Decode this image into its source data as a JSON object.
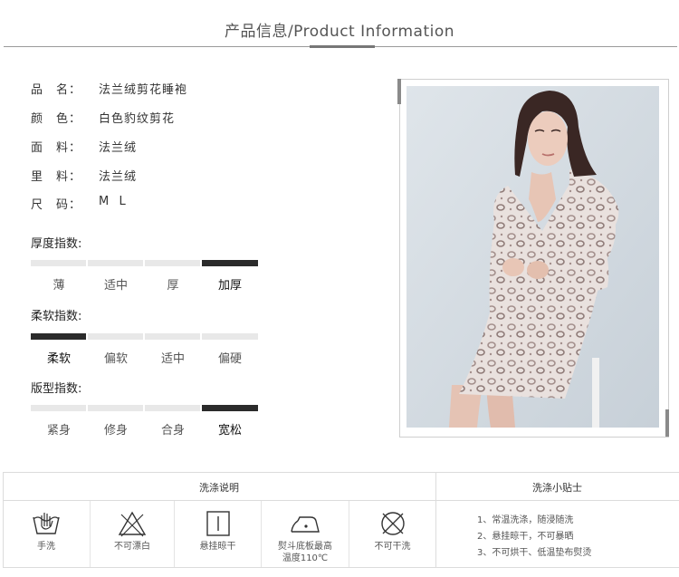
{
  "header": {
    "title": "产品信息/Product Information"
  },
  "specs": [
    {
      "label": "品　名：",
      "value": "法兰绒剪花睡袍"
    },
    {
      "label": "颜　色：",
      "value": "白色豹纹剪花"
    },
    {
      "label": "面　料：",
      "value": "法兰绒"
    },
    {
      "label": "里　料：",
      "value": "法兰绒"
    },
    {
      "label": "尺　码：",
      "value": "M  L"
    }
  ],
  "indices": [
    {
      "title": "厚度指数:",
      "options": [
        "薄",
        "适中",
        "厚",
        "加厚"
      ],
      "selected": "加厚"
    },
    {
      "title": "柔软指数:",
      "options": [
        "柔软",
        "偏软",
        "适中",
        "偏硬"
      ],
      "selected": "柔软"
    },
    {
      "title": "版型指数:",
      "options": [
        "紧身",
        "修身",
        "合身",
        "宽松"
      ],
      "selected": "宽松"
    }
  ],
  "care": {
    "wash_title": "洗涤说明",
    "tips_title": "洗涤小贴士",
    "icons": [
      {
        "icon": "hand-wash-icon",
        "label": "手洗"
      },
      {
        "icon": "no-bleach-icon",
        "label": "不可漂白"
      },
      {
        "icon": "hang-dry-icon",
        "label": "悬挂晾干"
      },
      {
        "icon": "iron-icon",
        "label": "熨斗底板最高",
        "label2": "温度110℃"
      },
      {
        "icon": "no-dry-clean-icon",
        "label": "不可干洗"
      }
    ],
    "tips": [
      "1、常温洗涤，随浸随洗",
      "2、悬挂晾干，不可暴晒",
      "3、不可烘干、低温垫布熨烫"
    ]
  },
  "colors": {
    "accent": "#2b2b2b",
    "inactive": "#e8e8e8",
    "photo_bg": "#d5dce2"
  }
}
